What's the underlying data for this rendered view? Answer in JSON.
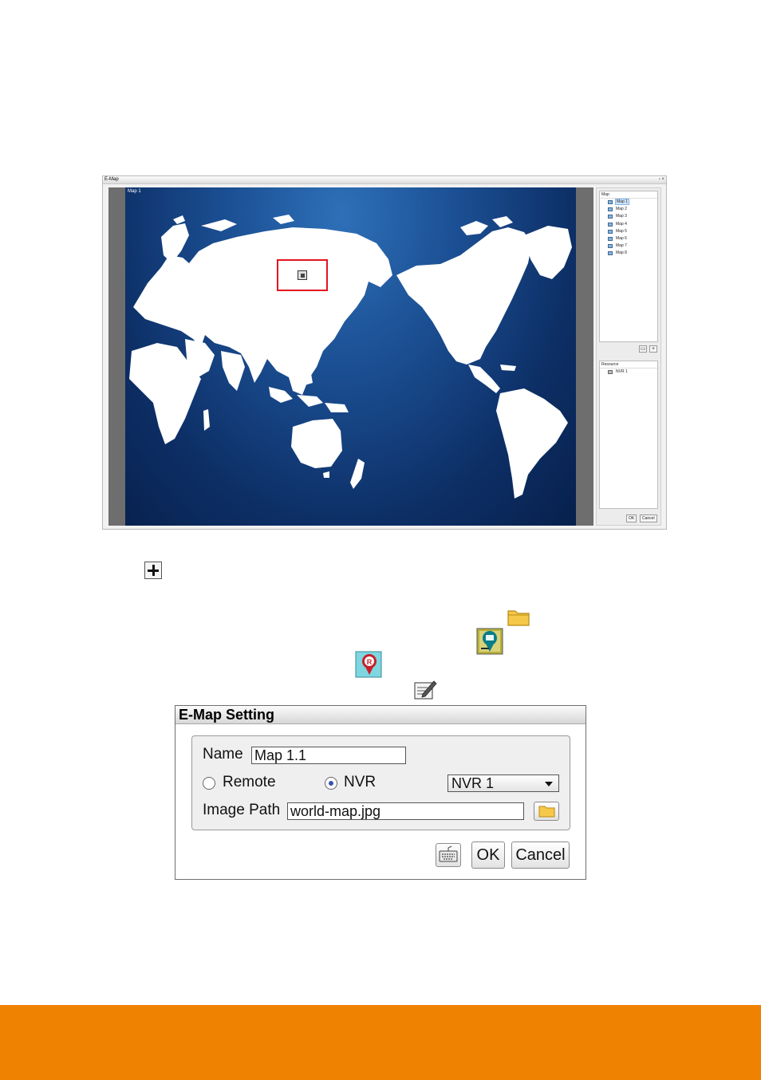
{
  "emap_window": {
    "title": "E-Map",
    "window_controls": "▫ ×",
    "map_tab_label": "Map 1",
    "map_section_header": "Map",
    "maps": [
      "Map 1",
      "Map 2",
      "Map 3",
      "Map 4",
      "Map 5",
      "Map 6",
      "Map 7",
      "Map 8"
    ],
    "selected_map_index": 0,
    "resource_section_header": "Resource",
    "resources": [
      "NVR 1"
    ],
    "ok_label": "OK",
    "cancel_label": "Cancel",
    "add_symbol": "+",
    "colors": {
      "marker_highlight": "#e4151f",
      "map_background": "#0d2f66"
    }
  },
  "inline_icons": [
    "plus-icon",
    "folder-icon",
    "camera-marker-icon",
    "record-marker-icon",
    "edit-icon"
  ],
  "dialog": {
    "title": "E-Map Setting",
    "name_label": "Name",
    "name_value": "Map 1.1",
    "remote_label": "Remote",
    "nvr_label": "NVR",
    "selected_source": "NVR",
    "nvr_select_value": "NVR 1",
    "image_path_label": "Image Path",
    "image_path_value": "world-map.jpg",
    "ok_label": "OK",
    "cancel_label": "Cancel"
  },
  "colors": {
    "footer_bar": "#ef8200"
  }
}
